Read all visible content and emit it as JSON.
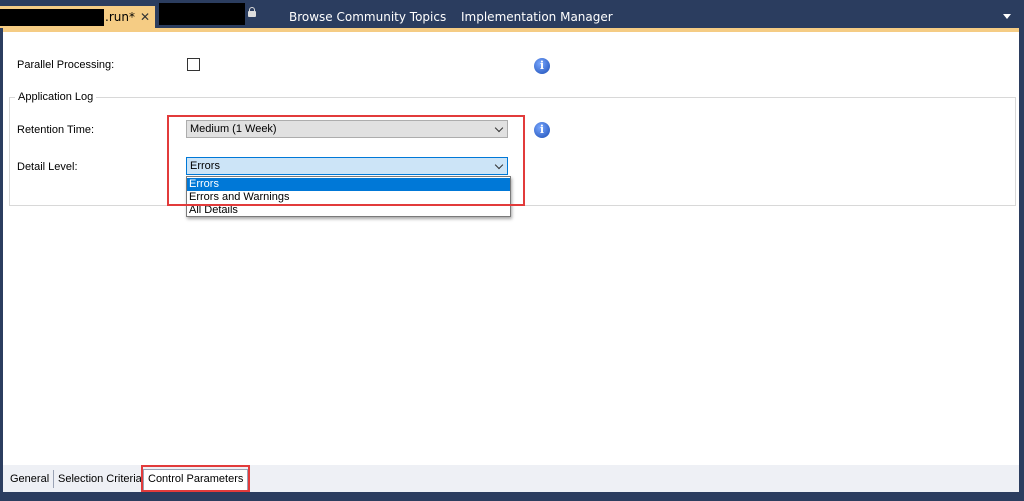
{
  "tabs": {
    "active_name": ".run*",
    "close_glyph": "✕",
    "browse": "Browse Community Topics",
    "impl": "Implementation Manager"
  },
  "form": {
    "parallel_label": "Parallel Processing:",
    "parallel_checked": false,
    "app_log_title": "Application Log",
    "retention_label": "Retention Time:",
    "retention_value": "Medium (1 Week)",
    "detail_label": "Detail Level:",
    "detail_value": "Errors",
    "detail_options": [
      "Errors",
      "Errors and Warnings",
      "All Details"
    ],
    "info_glyph": "i"
  },
  "bottom_tabs": [
    "General",
    "Selection Criteria",
    "Control Parameters"
  ],
  "colors": {
    "accent_tab": "#f5cc84",
    "chrome": "#2b3d5f",
    "highlight": "#e23b3b",
    "selection": "#0078d7"
  }
}
